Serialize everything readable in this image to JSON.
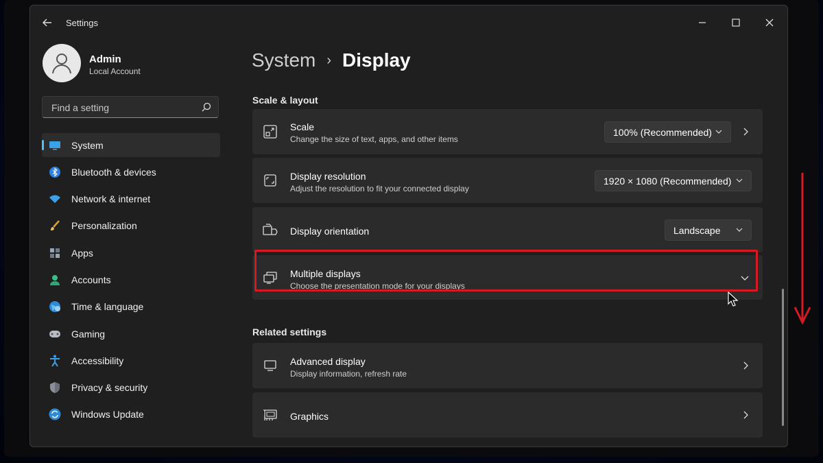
{
  "window": {
    "title": "Settings"
  },
  "user": {
    "name": "Admin",
    "account_type": "Local Account"
  },
  "search": {
    "placeholder": "Find a setting"
  },
  "sidebar": {
    "items": [
      {
        "label": "System",
        "icon": "system-icon",
        "active": true
      },
      {
        "label": "Bluetooth & devices",
        "icon": "bluetooth-icon"
      },
      {
        "label": "Network & internet",
        "icon": "wifi-icon"
      },
      {
        "label": "Personalization",
        "icon": "brush-icon"
      },
      {
        "label": "Apps",
        "icon": "apps-icon"
      },
      {
        "label": "Accounts",
        "icon": "accounts-icon"
      },
      {
        "label": "Time & language",
        "icon": "globe-icon"
      },
      {
        "label": "Gaming",
        "icon": "gamepad-icon"
      },
      {
        "label": "Accessibility",
        "icon": "accessibility-icon"
      },
      {
        "label": "Privacy & security",
        "icon": "shield-icon"
      },
      {
        "label": "Windows Update",
        "icon": "update-icon"
      }
    ]
  },
  "breadcrumb": {
    "parent": "System",
    "separator": "›",
    "current": "Display"
  },
  "scale_layout": {
    "heading": "Scale & layout",
    "scale": {
      "title": "Scale",
      "subtitle": "Change the size of text, apps, and other items",
      "value": "100% (Recommended)"
    },
    "resolution": {
      "title": "Display resolution",
      "subtitle": "Adjust the resolution to fit your connected display",
      "value": "1920 × 1080 (Recommended)"
    },
    "orientation": {
      "title": "Display orientation",
      "value": "Landscape"
    },
    "multiple": {
      "title": "Multiple displays",
      "subtitle": "Choose the presentation mode for your displays"
    }
  },
  "related": {
    "heading": "Related settings",
    "advanced": {
      "title": "Advanced display",
      "subtitle": "Display information, refresh rate"
    },
    "graphics": {
      "title": "Graphics"
    }
  },
  "colors": {
    "accent": "#4cc2ff",
    "highlight": "#d51a24",
    "card": "#2b2b2b",
    "background": "#1f1f1f"
  }
}
